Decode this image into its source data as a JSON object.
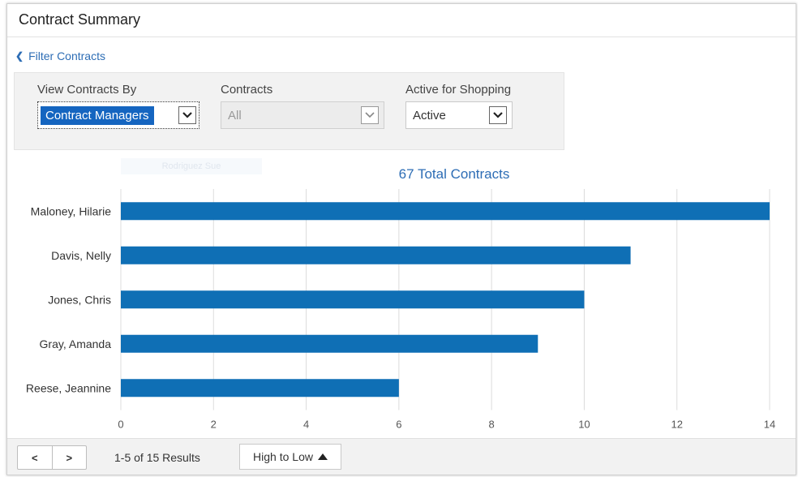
{
  "header": {
    "title": "Contract Summary"
  },
  "filter_link": {
    "label": "Filter Contracts",
    "icon": "chevron-left-icon"
  },
  "filters": {
    "view_by": {
      "label": "View Contracts By",
      "value": "Contract Managers"
    },
    "contracts": {
      "label": "Contracts",
      "value": "All"
    },
    "active": {
      "label": "Active for Shopping",
      "value": "Active"
    }
  },
  "ghost_text": "Rodriguez Sue",
  "total_label": "67 Total Contracts",
  "colors": {
    "bar": "#0f6fb5",
    "link": "#2d6db5",
    "grid": "#dcdcdc"
  },
  "chart_data": {
    "type": "bar",
    "orientation": "horizontal",
    "categories": [
      "Maloney, Hilarie",
      "Davis, Nelly",
      "Jones, Chris",
      "Gray, Amanda",
      "Reese, Jeannine"
    ],
    "values": [
      14,
      11,
      10,
      9,
      6
    ],
    "xlim": [
      0,
      14
    ],
    "xticks": [
      0,
      2,
      4,
      6,
      8,
      10,
      12,
      14
    ],
    "grid": true
  },
  "footer": {
    "prev_label": "<",
    "next_label": ">",
    "results_text": "1-5 of 15 Results",
    "sort_label": "High to Low"
  }
}
